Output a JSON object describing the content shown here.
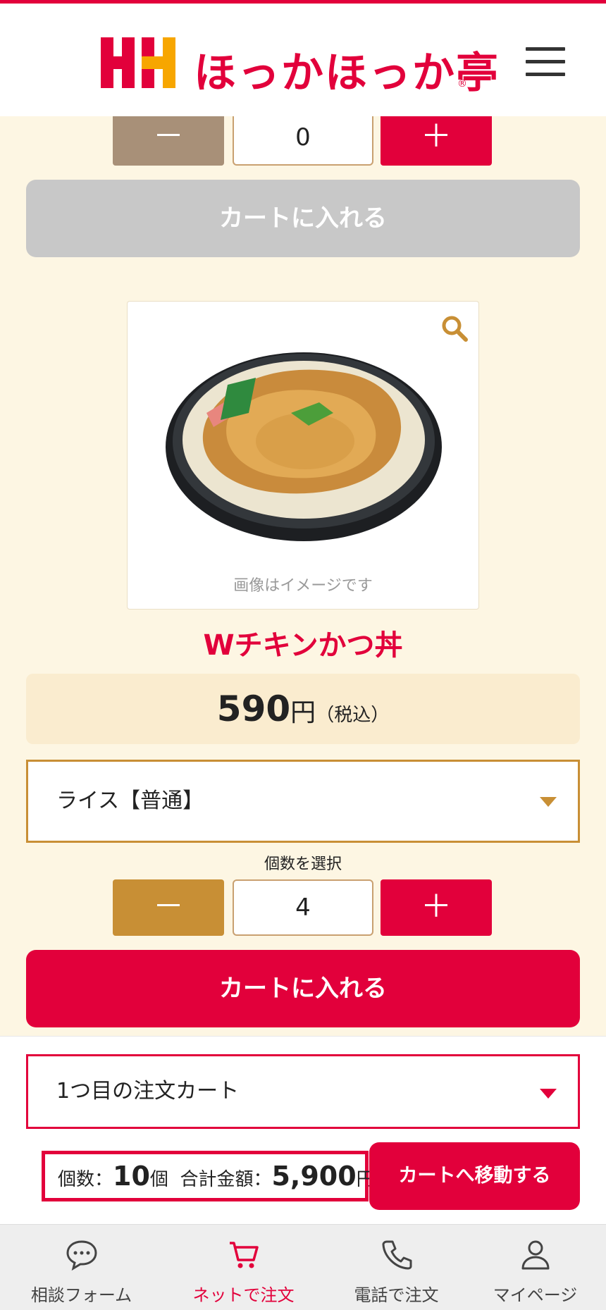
{
  "header": {
    "brand_name": "ほっかほっか亭",
    "registered_mark": "®",
    "menu_icon": "hamburger-menu-icon"
  },
  "prev_item": {
    "quantity": "0",
    "minus_label": "－",
    "plus_label": "＋",
    "add_to_cart_label": "カートに入れる"
  },
  "product": {
    "image_note": "画像はイメージです",
    "zoom_icon": "magnifier-icon",
    "name": "Wチキンかつ丼",
    "price_value": "590",
    "price_unit": "円",
    "price_tax": "（税込）",
    "rice_option": "ライス【普通】",
    "quantity_label": "個数を選択",
    "quantity": "4",
    "minus_label": "－",
    "plus_label": "＋",
    "add_to_cart_label": "カートに入れる"
  },
  "cart_bar": {
    "cart_select_label": "1つ目の注文カート",
    "count_label": "個数：",
    "count_value": "10",
    "count_unit": "個",
    "total_label": "合計金額：",
    "total_value": "5,900",
    "total_unit": "円",
    "goto_cart_label": "カートへ移動する"
  },
  "bottom_nav": [
    {
      "label": "相談フォーム",
      "icon": "chat-bubble-icon"
    },
    {
      "label": "ネットで注文",
      "icon": "cart-icon",
      "active": true
    },
    {
      "label": "電話で注文",
      "icon": "phone-icon"
    },
    {
      "label": "マイページ",
      "icon": "user-icon"
    }
  ],
  "colors": {
    "brand_red": "#e2003b",
    "brand_orange": "#f7a600",
    "accent_gold": "#c88f35",
    "minus_disabled": "#a89078",
    "page_bg": "#fdf6e3",
    "disabled_button": "#c8c8c8"
  }
}
